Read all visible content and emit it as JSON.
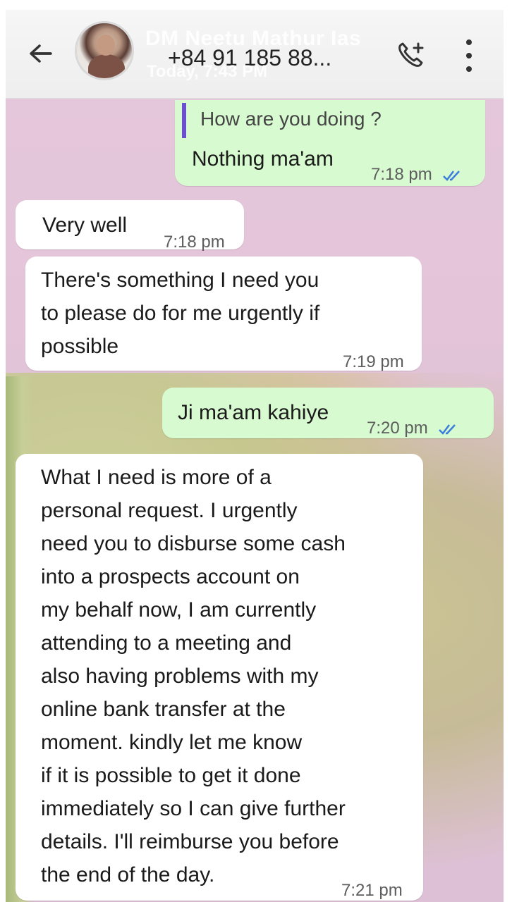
{
  "header": {
    "contact_name": "DM Neetu Mathur Ias",
    "contact_number": "+84 91 185 88...",
    "last_seen": "Today, 7:43 PM"
  },
  "messages": [
    {
      "direction": "outgoing",
      "quoted": "How are you doing ?",
      "text": "Nothing ma'am",
      "time": "7:18 pm",
      "status": "read"
    },
    {
      "direction": "incoming",
      "text": "Very well",
      "time": "7:18 pm"
    },
    {
      "direction": "incoming",
      "text": "There's something I need you\nto please do for me urgently if\npossible",
      "time": "7:19 pm"
    },
    {
      "direction": "outgoing",
      "text": "Ji ma'am kahiye",
      "time": "7:20 pm",
      "status": "read"
    },
    {
      "direction": "incoming",
      "text": "What I need is more of a\npersonal request. I urgently\nneed you to disburse some cash\ninto a prospects  account on\nmy behalf now, I am currently\nattending to a meeting and\nalso having problems with my\nonline bank transfer at the\nmoment. kindly let me know\nif it is possible to get it done\nimmediately so I can give further\ndetails. I'll reimburse you before\nthe end of the day.",
      "time": "7:21 pm"
    }
  ],
  "colors": {
    "outgoing_bubble": "#d8fad0",
    "incoming_bubble": "#ffffff",
    "read_ticks": "#3b7ddd",
    "quote_bar": "#6a4fd0",
    "chat_background": "#e2c3d8"
  },
  "icons": {
    "back": "arrow-left-icon",
    "call": "add-call-icon",
    "menu": "more-vertical-icon"
  }
}
